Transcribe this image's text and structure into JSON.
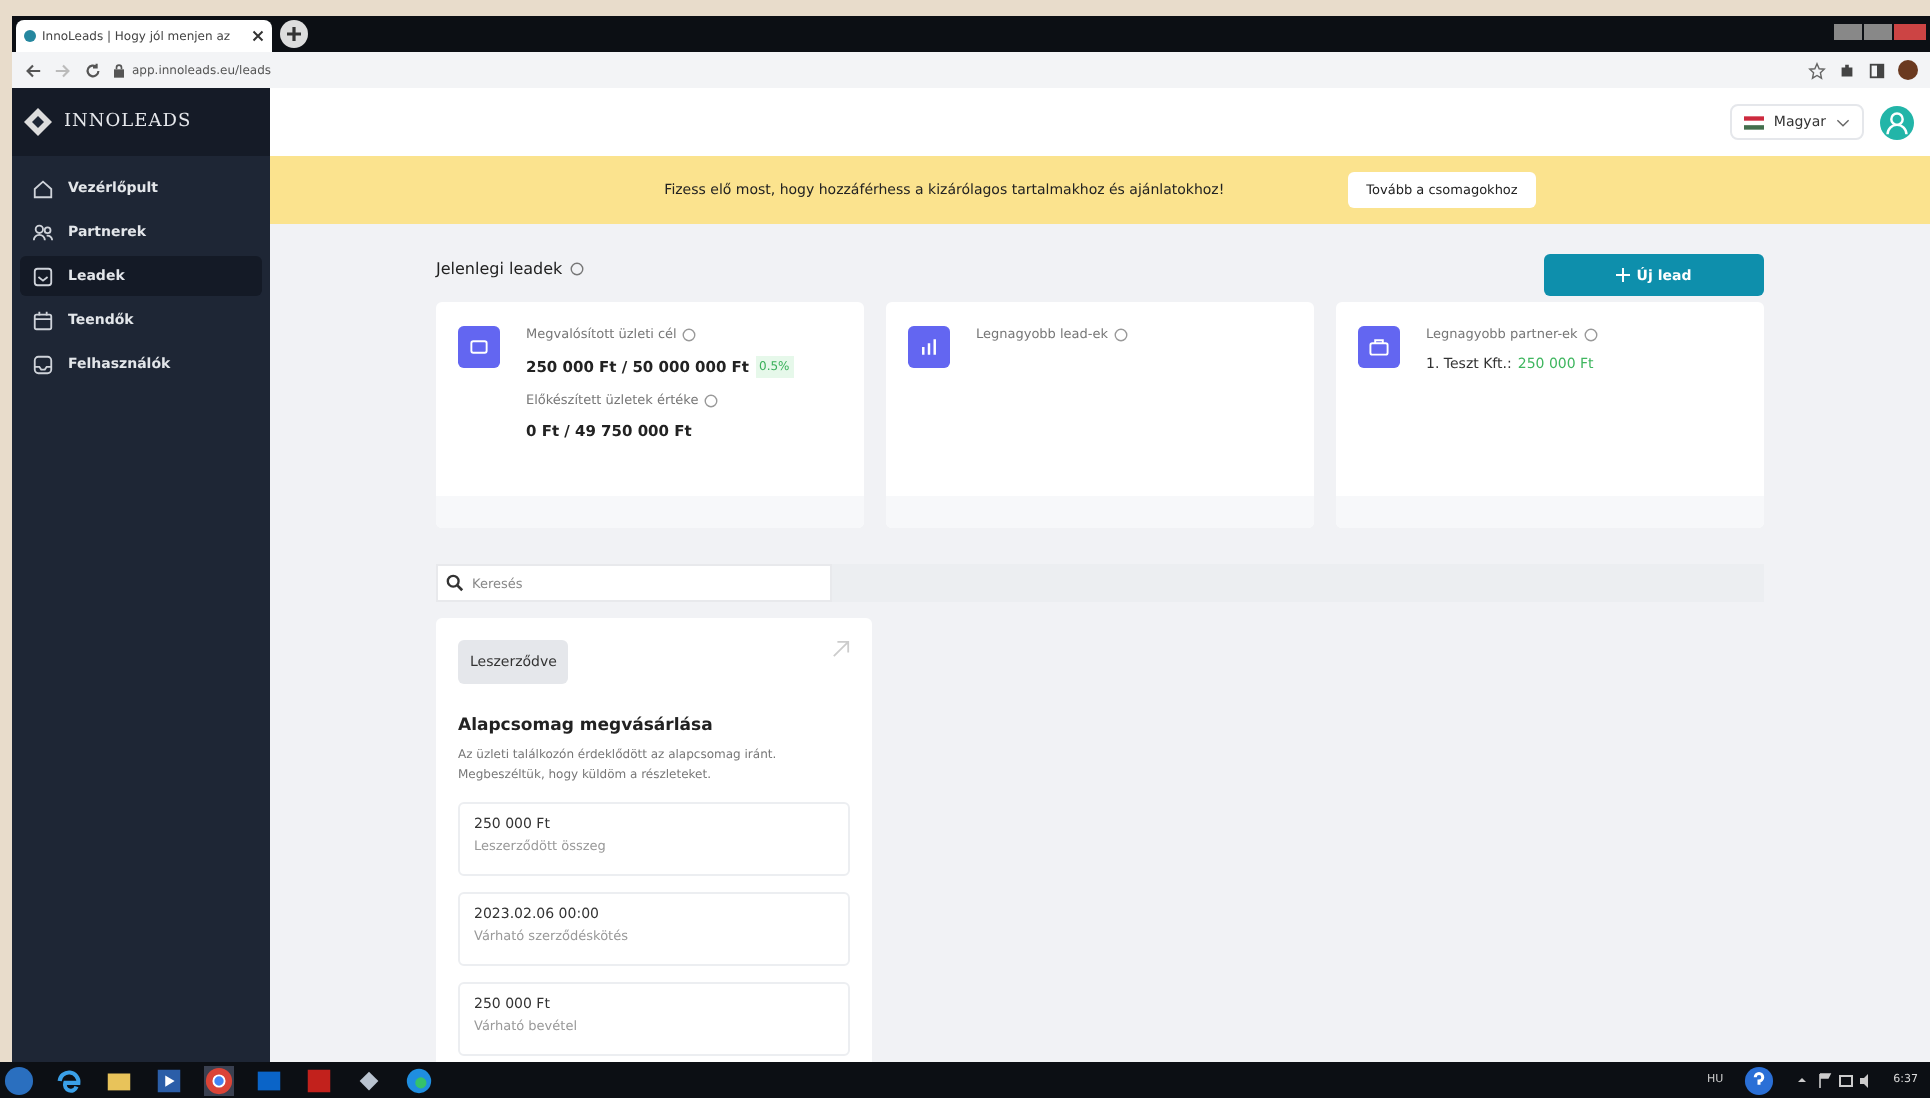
{
  "browser": {
    "tab_title": "InnoLeads | Hogy jól menjen az",
    "url": "app.innoleads.eu/leads"
  },
  "app": {
    "brand": "INNOLEADS",
    "sidebar": {
      "items": [
        {
          "label": "Vezérlőpult",
          "selected": false
        },
        {
          "label": "Partnerek",
          "selected": false
        },
        {
          "label": "Leadek",
          "selected": true
        },
        {
          "label": "Teendők",
          "selected": false
        },
        {
          "label": "Felhasználók",
          "selected": false
        }
      ]
    },
    "header": {
      "language": "Magyar"
    },
    "banner": {
      "text": "Fizess elő most, hogy hozzáférhess a kizárólagos tartalmakhoz és ajánlatokhoz!",
      "button": "Tovább a csomagokhoz"
    },
    "page_title": "Jelenlegi leadek",
    "new_button": "Új lead",
    "stat_cards": [
      {
        "items": [
          {
            "kind": "label",
            "text": "Megvalósított üzleti cél"
          },
          {
            "kind": "value",
            "text": "250 000 Ft / 50 000 000 Ft",
            "badge": "0.5%"
          },
          {
            "kind": "label",
            "text": "Előkészített üzletek értéke"
          },
          {
            "kind": "value",
            "text": "0 Ft / 49 750 000 Ft"
          }
        ]
      },
      {
        "items": [
          {
            "kind": "label",
            "text": "Legnagyobb lead-ek"
          }
        ]
      },
      {
        "items": [
          {
            "kind": "label",
            "text": "Legnagyobb partner-ek"
          },
          {
            "kind": "entry",
            "text": "1. Teszt Kft.:",
            "amount": "250 000 Ft"
          }
        ]
      }
    ],
    "search": {
      "placeholder": "Keresés"
    },
    "lead_card": {
      "status": "Leszerződve",
      "title": "Alapcsomag megvásárlása",
      "description": "Az üzleti találkozón érdeklődött az alapcsomag iránt. Megbeszéltük, hogy küldöm a részleteket.",
      "fields": [
        {
          "value": "250 000 Ft",
          "label": "Leszerződött összeg"
        },
        {
          "value": "2023.02.06 00:00",
          "label": "Várható szerződéskötés"
        },
        {
          "value": "250 000 Ft",
          "label": "Várható bevétel"
        }
      ]
    }
  },
  "taskbar": {
    "language": "HU",
    "time": "6:37"
  }
}
